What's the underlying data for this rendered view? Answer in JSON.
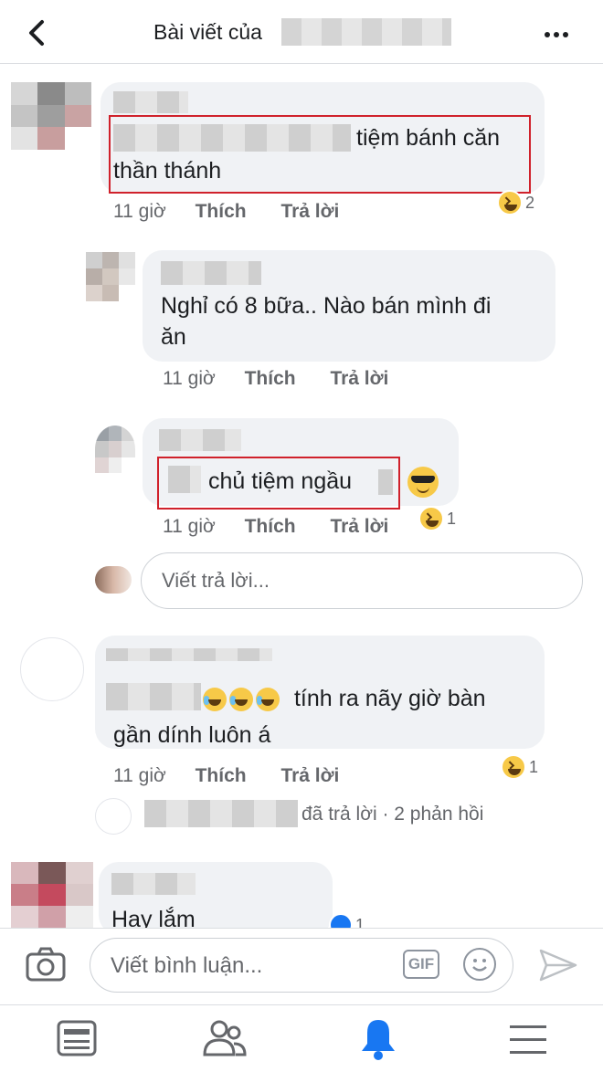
{
  "header": {
    "title": "Bài viết của"
  },
  "comments": [
    {
      "text_line1": "tiệm bánh căn",
      "text_line2": "thần thánh",
      "time": "11 giờ",
      "like_label": "Thích",
      "reply_label": "Trả lời",
      "reaction_count": "2"
    },
    {
      "text_line1": "Nghỉ có 8 bữa.. Nào bán mình đi",
      "text_line2": "ăn",
      "time": "11 giờ",
      "like_label": "Thích",
      "reply_label": "Trả lời"
    },
    {
      "text": "chủ tiệm ngầu",
      "time": "11 giờ",
      "like_label": "Thích",
      "reply_label": "Trả lời",
      "reaction_count": "1"
    },
    {
      "text_line1": "tính ra nãy giờ bàn",
      "text_line2": "gần dính luôn á",
      "time": "11 giờ",
      "like_label": "Thích",
      "reply_label": "Trả lời",
      "reaction_count": "1",
      "replies_summary": "đã trả lời · 2 phản hồi"
    },
    {
      "text": "Hay lắm",
      "reaction_count": "1"
    }
  ],
  "reply_box": {
    "placeholder": "Viết trả lời..."
  },
  "comment_bar": {
    "placeholder": "Viết bình luận...",
    "gif_label": "GIF"
  },
  "icons": {
    "back": "chevron-left-icon",
    "more": "more-horizontal-icon",
    "camera": "camera-icon",
    "emoji": "smiley-icon",
    "send": "send-icon",
    "feed": "news-feed-icon",
    "friends": "friends-icon",
    "notifications": "bell-icon",
    "menu": "menu-icon"
  },
  "colors": {
    "accent": "#1877f2",
    "highlight_box": "#d0212b"
  }
}
